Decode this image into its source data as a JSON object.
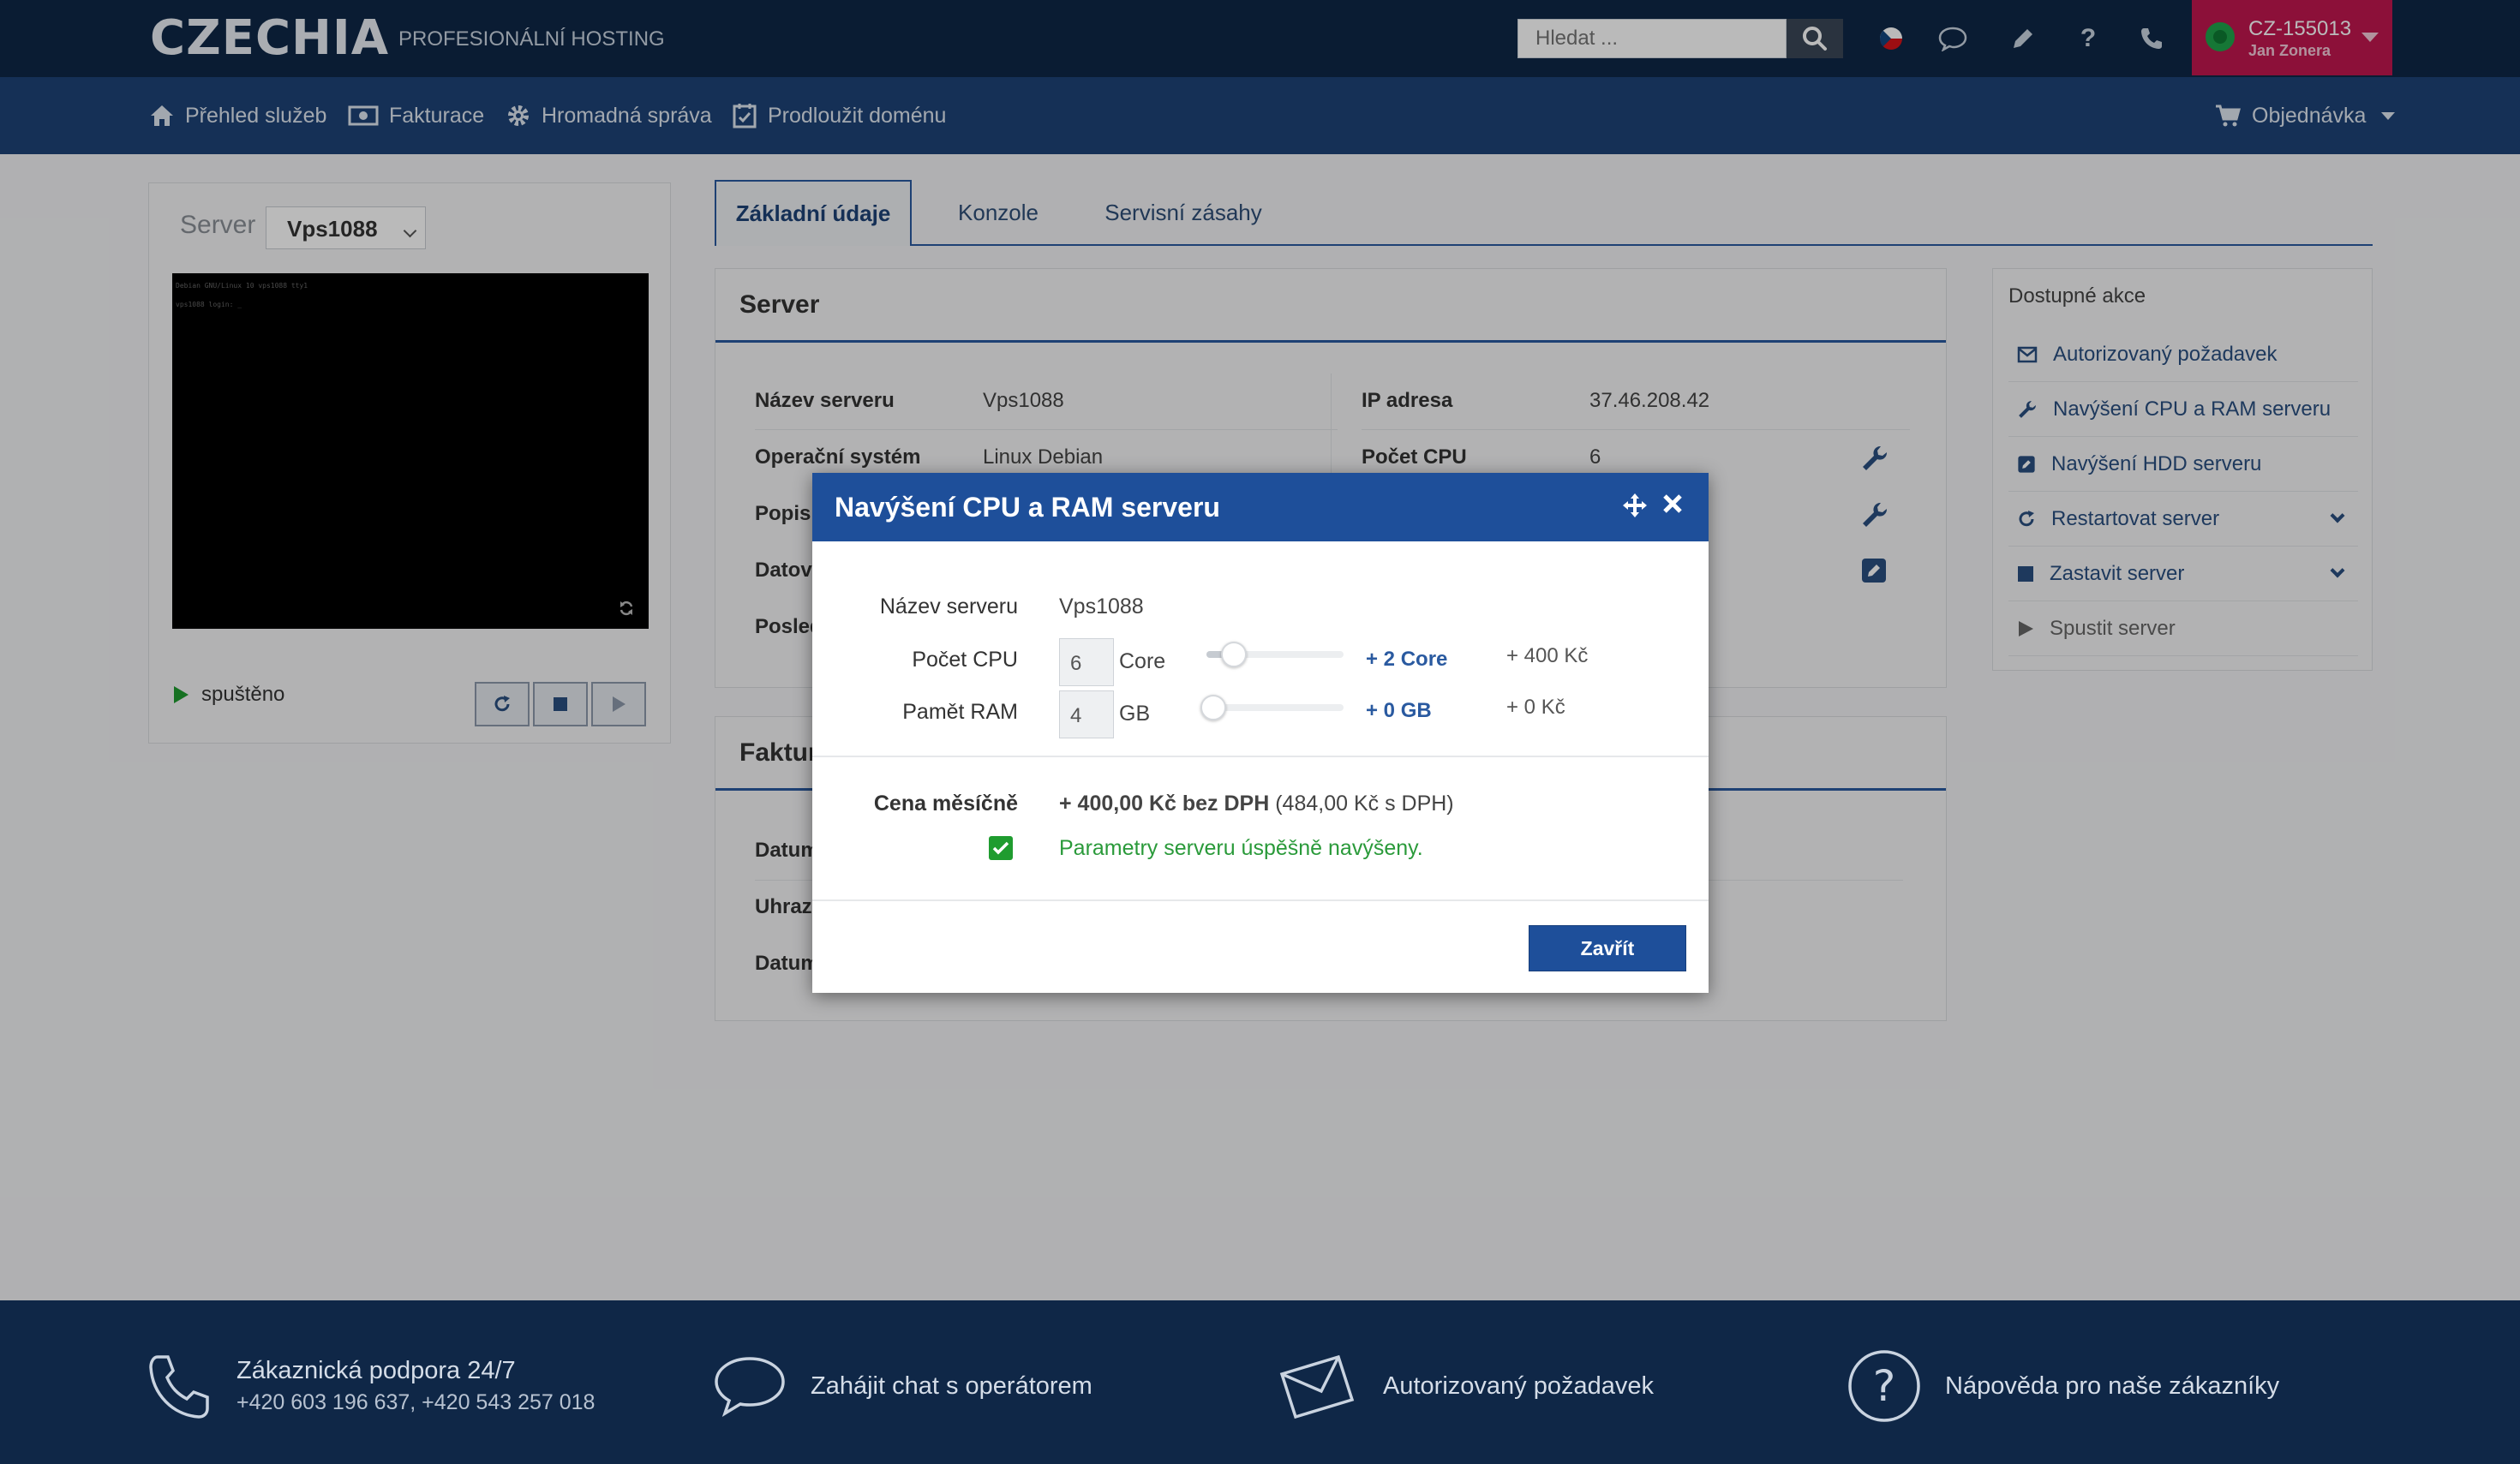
{
  "header": {
    "logo": "CZECHIA",
    "tagline": "PROFESIONÁLNÍ HOSTING",
    "search_placeholder": "Hledat ...",
    "user_id": "CZ-155013",
    "user_name": "Jan Zonera"
  },
  "nav": {
    "items": [
      {
        "label": "Přehled služeb",
        "icon": "home-icon"
      },
      {
        "label": "Fakturace",
        "icon": "money-icon"
      },
      {
        "label": "Hromadná správa",
        "icon": "gear-icon"
      },
      {
        "label": "Prodloužit doménu",
        "icon": "calendar-check-icon"
      }
    ],
    "order_label": "Objednávka"
  },
  "left_panel": {
    "server_label": "Server",
    "server_value": "Vps1088",
    "console_lines": [
      "Debian GNU/Linux 10 vps1088 tty1",
      "vps1088 login: _"
    ],
    "status": "spuštěno"
  },
  "tabs": [
    {
      "label": "Základní údaje",
      "active": true
    },
    {
      "label": "Konzole",
      "active": false
    },
    {
      "label": "Servisní zásahy",
      "active": false
    }
  ],
  "server_box": {
    "title": "Server",
    "left_rows": [
      {
        "label": "Název serveru",
        "value": "Vps1088"
      },
      {
        "label": "Operační systém",
        "value": "Linux Debian"
      },
      {
        "label": "Popis",
        "value": ""
      },
      {
        "label": "Datov",
        "value": ""
      },
      {
        "label": "Posled",
        "value": ""
      }
    ],
    "right_rows": [
      {
        "label": "IP adresa",
        "value": "37.46.208.42"
      },
      {
        "label": "Počet CPU",
        "value": "6"
      }
    ]
  },
  "invoice_box": {
    "title": "Faktur",
    "rows": [
      "Datum",
      "Uhraz",
      "Datum"
    ]
  },
  "actions": {
    "title": "Dostupné akce",
    "items": [
      {
        "label": "Autorizovaný požadavek",
        "icon": "envelope-icon",
        "expandable": false
      },
      {
        "label": "Navýšení CPU a RAM serveru",
        "icon": "wrench-icon",
        "expandable": false
      },
      {
        "label": "Navýšení HDD serveru",
        "icon": "edit-icon",
        "expandable": false
      },
      {
        "label": "Restartovat server",
        "icon": "restart-icon",
        "expandable": true
      },
      {
        "label": "Zastavit server",
        "icon": "stop-icon",
        "expandable": true
      },
      {
        "label": "Spustit server",
        "icon": "play-icon",
        "expandable": false
      }
    ]
  },
  "modal": {
    "title": "Navýšení CPU a RAM serveru",
    "server_name_label": "Název serveru",
    "server_name_value": "Vps1088",
    "cpu_label": "Počet CPU",
    "cpu_value": "6",
    "cpu_unit": "Core",
    "cpu_add": "+ 2 Core",
    "cpu_price": "+ 400 Kč",
    "cpu_slider_fraction": 0.15,
    "ram_label": "Pamět RAM",
    "ram_value": "4",
    "ram_unit": "GB",
    "ram_add": "+ 0 GB",
    "ram_price": "+ 0 Kč",
    "ram_slider_fraction": 0.0,
    "price_label": "Cena měsíčně",
    "price_main": "+ 400,00 Kč bez DPH",
    "price_vat": "(484,00 Kč s DPH)",
    "success_message": "Parametry serveru úspěšně navýšeny.",
    "close_label": "Zavřít"
  },
  "footer": {
    "support_title": "Zákaznická podpora 24/7",
    "support_phones": "+420 603 196 637, +420 543 257 018",
    "chat": "Zahájit chat s operátorem",
    "request": "Autorizovaný požadavek",
    "help": "Nápověda pro naše zákazníky"
  },
  "colors": {
    "header_bg": "#0f2747",
    "nav_bg": "#1e4276",
    "accent": "#1e4f9a",
    "user_badge": "#c0174f",
    "success": "#2a9a3a"
  }
}
